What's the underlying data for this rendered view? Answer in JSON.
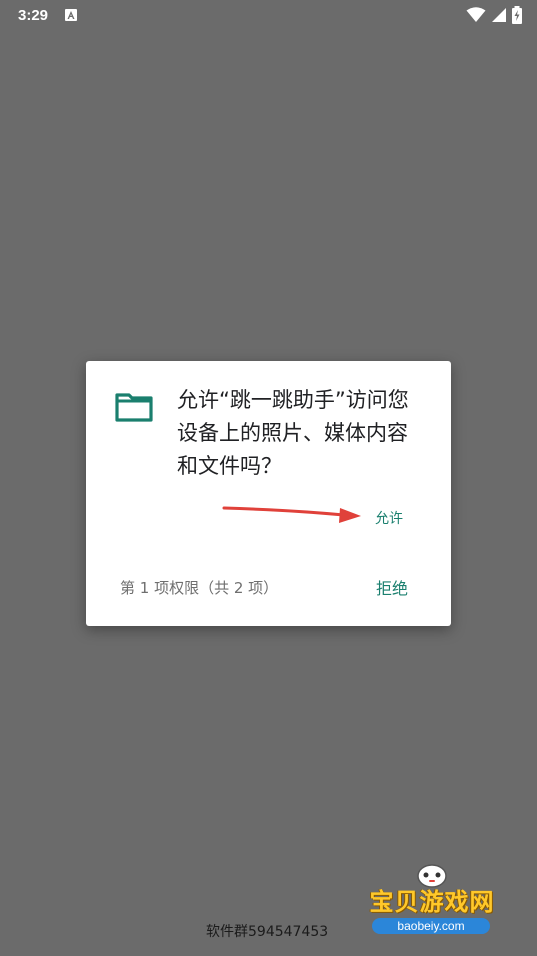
{
  "status_bar": {
    "time": "3:29",
    "icons": [
      "a-notification-icon",
      "wifi-icon",
      "signal-icon",
      "battery-charging-icon"
    ]
  },
  "dialog": {
    "message": "允许“跳一跳助手”访问您设备上的照片、媒体内容和文件吗？",
    "allow_label": "允许",
    "deny_label": "拒绝",
    "permission_counter": "第 1 项权限（共 2 项）",
    "icon": "folder-icon",
    "accent_color": "#1a7f6e"
  },
  "footer": {
    "group_text": "软件群594547453"
  },
  "watermark": {
    "title": "宝贝游戏网",
    "url": "baobeiy.com"
  },
  "colors": {
    "scrim": "#6b6b6b",
    "dialog_bg": "#ffffff",
    "arrow": "#e0413a"
  }
}
